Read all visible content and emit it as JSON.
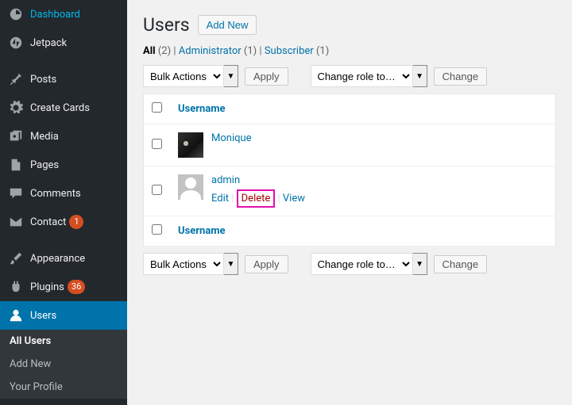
{
  "sidebar": {
    "items": [
      {
        "label": "Dashboard"
      },
      {
        "label": "Jetpack"
      },
      {
        "label": "Posts"
      },
      {
        "label": "Create Cards"
      },
      {
        "label": "Media"
      },
      {
        "label": "Pages"
      },
      {
        "label": "Comments"
      },
      {
        "label": "Contact",
        "badge": "1"
      },
      {
        "label": "Appearance"
      },
      {
        "label": "Plugins",
        "badge": "36"
      },
      {
        "label": "Users"
      }
    ],
    "submenu": [
      {
        "label": "All Users"
      },
      {
        "label": "Add New"
      },
      {
        "label": "Your Profile"
      }
    ]
  },
  "header": {
    "title": "Users",
    "add_new": "Add New"
  },
  "filters": {
    "all_label": "All",
    "all_count": "(2)",
    "sep": " | ",
    "admin_label": "Administrator",
    "admin_count": "(1)",
    "sub_label": "Subscriber",
    "sub_count": "(1)"
  },
  "controls": {
    "bulk": "Bulk Actions",
    "apply": "Apply",
    "role": "Change role to…",
    "change": "Change"
  },
  "table": {
    "col_username": "Username",
    "rows": [
      {
        "username": "Monique",
        "avatar": "photo"
      },
      {
        "username": "admin",
        "avatar": "default",
        "actions": {
          "edit": "Edit",
          "delete": "Delete",
          "view": "View"
        }
      }
    ]
  }
}
